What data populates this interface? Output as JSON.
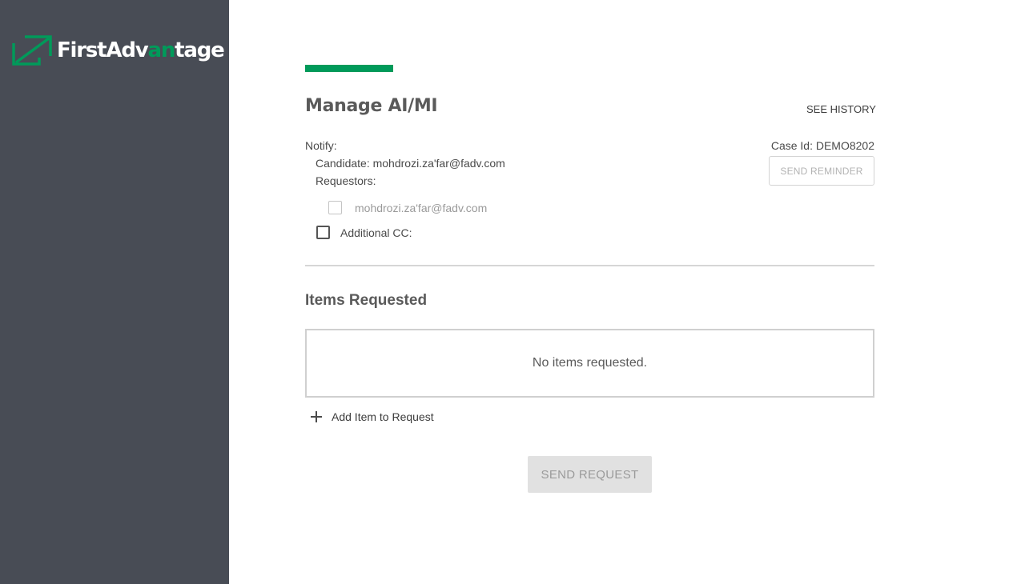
{
  "brand": {
    "name_part1": "FirstAdv",
    "name_part2": "an",
    "name_part3": "tage",
    "accent_color": "#009a5a",
    "sidebar_color": "#484c55"
  },
  "header": {
    "title": "Manage AI/MI",
    "see_history_label": "SEE HISTORY"
  },
  "notify": {
    "label": "Notify:",
    "candidate": "Candidate: mohdrozi.za'far@fadv.com",
    "requestors_label": "Requestors:",
    "requestors": [
      {
        "email": "mohdrozi.za'far@fadv.com",
        "checked": false,
        "disabled": true
      }
    ],
    "additional_cc_label": "Additional CC:",
    "additional_cc_checked": false
  },
  "case": {
    "case_id": "Case Id: DEMO8202",
    "send_reminder_label": "SEND REMINDER"
  },
  "items": {
    "title": "Items Requested",
    "empty_message": "No items requested.",
    "add_item_label": "Add Item to Request"
  },
  "footer": {
    "send_request_label": "SEND REQUEST"
  }
}
